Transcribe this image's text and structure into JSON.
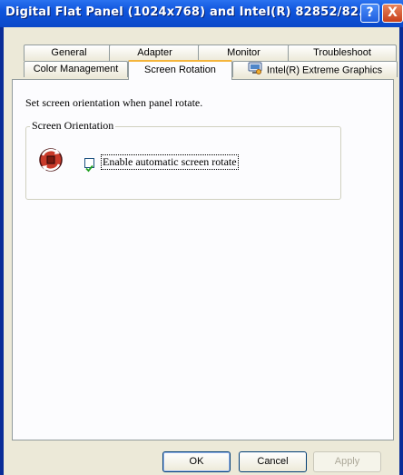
{
  "window": {
    "title": "Digital Flat Panel (1024x768) and Intel(R) 82852/82...",
    "help_label": "?",
    "close_label": "X"
  },
  "tabs": {
    "row1": [
      "General",
      "Adapter",
      "Monitor",
      "Troubleshoot"
    ],
    "row2": [
      "Color Management",
      "Screen Rotation",
      "Intel(R) Extreme Graphics"
    ],
    "active": "Screen Rotation"
  },
  "panel": {
    "instruction": "Set screen orientation when panel rotate.",
    "group_title": "Screen Orientation",
    "checkbox_label": "Enable automatic screen rotate",
    "checkbox_checked": true
  },
  "buttons": {
    "ok": "OK",
    "cancel": "Cancel",
    "apply": "Apply"
  },
  "colors": {
    "titlebar": "#0f54dc",
    "dialog_bg": "#ece9d8",
    "active_tab_accent": "#f4b53c"
  }
}
